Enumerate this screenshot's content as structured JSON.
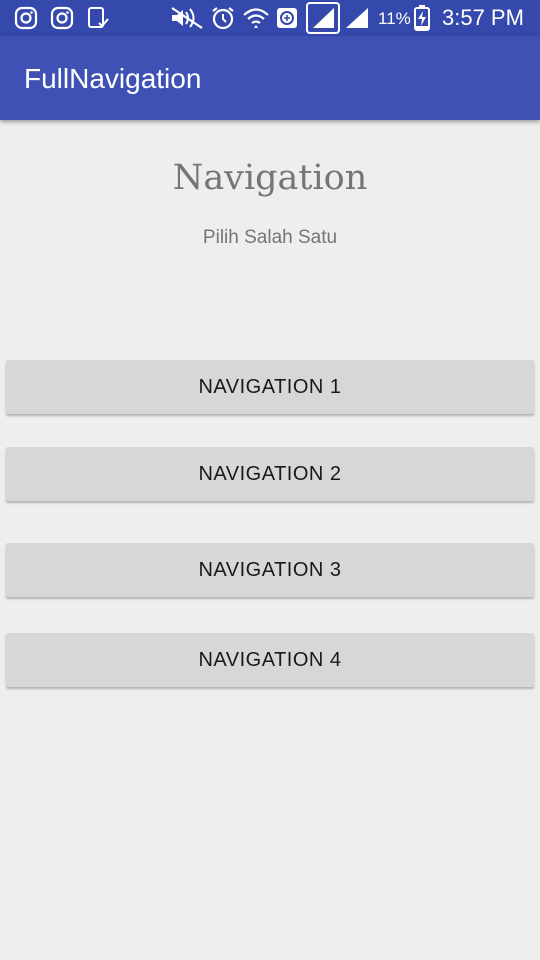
{
  "status_bar": {
    "icons": [
      "instagram-icon",
      "instagram-icon",
      "clipboard-check-icon",
      "mute-icon",
      "alarm-icon",
      "wifi-icon",
      "data-saver-icon",
      "signal-icon",
      "signal-icon",
      "battery-charging-icon"
    ],
    "battery_percent": "11%",
    "time": "3:57 PM"
  },
  "app_bar": {
    "title": "FullNavigation",
    "color": "#3f51b5"
  },
  "main": {
    "title": "Navigation",
    "subtitle": "Pilih Salah Satu",
    "buttons": [
      {
        "label": "NAVIGATION 1"
      },
      {
        "label": "NAVIGATION 2"
      },
      {
        "label": "NAVIGATION 3"
      },
      {
        "label": "NAVIGATION 4"
      }
    ]
  }
}
